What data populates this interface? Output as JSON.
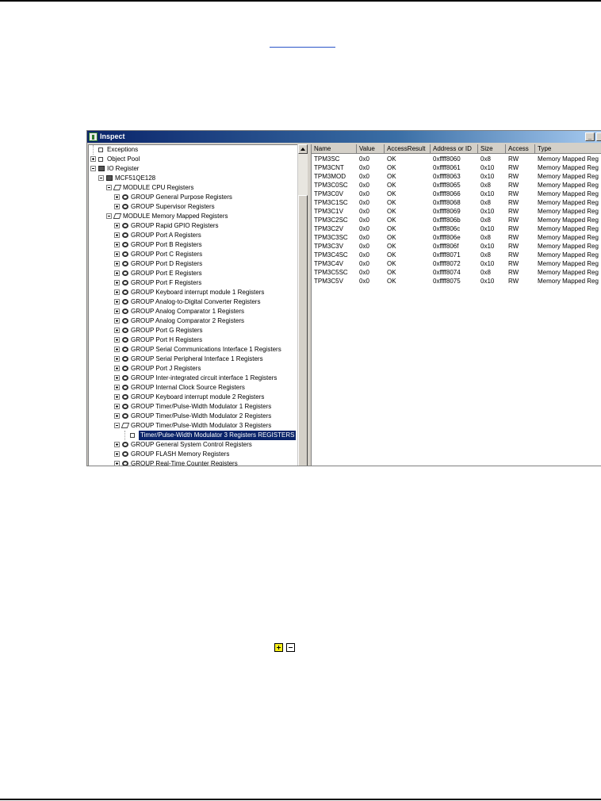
{
  "window": {
    "title": "Inspect",
    "minimize_label": "_"
  },
  "tree": [
    {
      "label": "Exceptions",
      "icon": "exceptions-icon",
      "expander": "none",
      "selected": false
    },
    {
      "label": "Object Pool",
      "icon": "object-pool-icon",
      "expander": "plus",
      "selected": false
    },
    {
      "label": "IO Register",
      "icon": "io-register-icon",
      "expander": "minus",
      "selected": false
    },
    {
      "label": "MCF51QE128",
      "icon": "chip-icon",
      "expander": "minus",
      "selected": false
    },
    {
      "label": "MODULE CPU Registers",
      "icon": "module-icon",
      "expander": "minus",
      "selected": false
    },
    {
      "label": "GROUP General Purpose Registers",
      "icon": "group-icon",
      "expander": "plus",
      "selected": false
    },
    {
      "label": "GROUP Supervisor Registers",
      "icon": "group-icon",
      "expander": "plus",
      "selected": false
    },
    {
      "label": "MODULE Memory Mapped Registers",
      "icon": "module-icon",
      "expander": "minus",
      "selected": false
    },
    {
      "label": "GROUP Rapid GPIO Registers",
      "icon": "group-icon",
      "expander": "plus",
      "selected": false
    },
    {
      "label": "GROUP Port A Registers",
      "icon": "group-icon",
      "expander": "plus",
      "selected": false
    },
    {
      "label": "GROUP Port B Registers",
      "icon": "group-icon",
      "expander": "plus",
      "selected": false
    },
    {
      "label": "GROUP Port C Registers",
      "icon": "group-icon",
      "expander": "plus",
      "selected": false
    },
    {
      "label": "GROUP Port D Registers",
      "icon": "group-icon",
      "expander": "plus",
      "selected": false
    },
    {
      "label": "GROUP Port E Registers",
      "icon": "group-icon",
      "expander": "plus",
      "selected": false
    },
    {
      "label": "GROUP Port F Registers",
      "icon": "group-icon",
      "expander": "plus",
      "selected": false
    },
    {
      "label": "GROUP Keyboard interrupt module 1 Registers",
      "icon": "group-icon",
      "expander": "plus",
      "selected": false
    },
    {
      "label": "GROUP Analog-to-Digital Converter Registers",
      "icon": "group-icon",
      "expander": "plus",
      "selected": false
    },
    {
      "label": "GROUP Analog Comparator 1 Registers",
      "icon": "group-icon",
      "expander": "plus",
      "selected": false
    },
    {
      "label": "GROUP Analog Comparator 2 Registers",
      "icon": "group-icon",
      "expander": "plus",
      "selected": false
    },
    {
      "label": "GROUP Port G Registers",
      "icon": "group-icon",
      "expander": "plus",
      "selected": false
    },
    {
      "label": "GROUP Port H Registers",
      "icon": "group-icon",
      "expander": "plus",
      "selected": false
    },
    {
      "label": "GROUP Serial Communications Interface 1 Registers",
      "icon": "group-icon",
      "expander": "plus",
      "selected": false
    },
    {
      "label": "GROUP Serial Peripheral Interface 1 Registers",
      "icon": "group-icon",
      "expander": "plus",
      "selected": false
    },
    {
      "label": "GROUP Port J Registers",
      "icon": "group-icon",
      "expander": "plus",
      "selected": false
    },
    {
      "label": "GROUP Inter-integrated circuit interface 1 Registers",
      "icon": "group-icon",
      "expander": "plus",
      "selected": false
    },
    {
      "label": "GROUP Internal Clock Source Registers",
      "icon": "group-icon",
      "expander": "plus",
      "selected": false
    },
    {
      "label": "GROUP Keyboard interrupt module 2 Registers",
      "icon": "group-icon",
      "expander": "plus",
      "selected": false
    },
    {
      "label": "GROUP Timer/Pulse-Width Modulator 1 Registers",
      "icon": "group-icon",
      "expander": "plus",
      "selected": false
    },
    {
      "label": "GROUP Timer/Pulse-Width Modulator 2 Registers",
      "icon": "group-icon",
      "expander": "plus",
      "selected": false
    },
    {
      "label": "GROUP Timer/Pulse-Width Modulator 3 Registers",
      "icon": "module-icon",
      "expander": "minus",
      "selected": false
    },
    {
      "label": "Timer/Pulse-Width Modulator 3 Registers REGISTERS",
      "icon": "register-list-icon",
      "expander": "none",
      "selected": true
    },
    {
      "label": "GROUP General System Control Registers",
      "icon": "group-icon",
      "expander": "plus",
      "selected": false
    },
    {
      "label": "GROUP FLASH Memory Registers",
      "icon": "group-icon",
      "expander": "plus",
      "selected": false
    },
    {
      "label": "GROUP Real-Time Counter Registers",
      "icon": "group-icon",
      "expander": "plus",
      "selected": false
    }
  ],
  "table": {
    "columns": [
      "Name",
      "Value",
      "AccessResult",
      "Address or ID",
      "Size",
      "Access",
      "Type"
    ],
    "rows": [
      [
        "TPM3SC",
        "0x0",
        "OK",
        "0xffff8060",
        "0x8",
        "RW",
        "Memory Mapped Reg"
      ],
      [
        "TPM3CNT",
        "0x0",
        "OK",
        "0xffff8061",
        "0x10",
        "RW",
        "Memory Mapped Reg"
      ],
      [
        "TPM3MOD",
        "0x0",
        "OK",
        "0xffff8063",
        "0x10",
        "RW",
        "Memory Mapped Reg"
      ],
      [
        "TPM3C0SC",
        "0x0",
        "OK",
        "0xffff8065",
        "0x8",
        "RW",
        "Memory Mapped Reg"
      ],
      [
        "TPM3C0V",
        "0x0",
        "OK",
        "0xffff8066",
        "0x10",
        "RW",
        "Memory Mapped Reg"
      ],
      [
        "TPM3C1SC",
        "0x0",
        "OK",
        "0xffff8068",
        "0x8",
        "RW",
        "Memory Mapped Reg"
      ],
      [
        "TPM3C1V",
        "0x0",
        "OK",
        "0xffff8069",
        "0x10",
        "RW",
        "Memory Mapped Reg"
      ],
      [
        "TPM3C2SC",
        "0x0",
        "OK",
        "0xffff806b",
        "0x8",
        "RW",
        "Memory Mapped Reg"
      ],
      [
        "TPM3C2V",
        "0x0",
        "OK",
        "0xffff806c",
        "0x10",
        "RW",
        "Memory Mapped Reg"
      ],
      [
        "TPM3C3SC",
        "0x0",
        "OK",
        "0xffff806e",
        "0x8",
        "RW",
        "Memory Mapped Reg"
      ],
      [
        "TPM3C3V",
        "0x0",
        "OK",
        "0xffff806f",
        "0x10",
        "RW",
        "Memory Mapped Reg"
      ],
      [
        "TPM3C4SC",
        "0x0",
        "OK",
        "0xffff8071",
        "0x8",
        "RW",
        "Memory Mapped Reg"
      ],
      [
        "TPM3C4V",
        "0x0",
        "OK",
        "0xffff8072",
        "0x10",
        "RW",
        "Memory Mapped Reg"
      ],
      [
        "TPM3C5SC",
        "0x0",
        "OK",
        "0xffff8074",
        "0x8",
        "RW",
        "Memory Mapped Reg"
      ],
      [
        "TPM3C5V",
        "0x0",
        "OK",
        "0xffff8075",
        "0x10",
        "RW",
        "Memory Mapped Reg"
      ]
    ]
  },
  "doc_icons": [
    "expand-plus-icon",
    "collapse-minus-icon"
  ],
  "colors": {
    "titlebar": "#0a246a",
    "selection": "#0a246a",
    "link": "#2a55c8",
    "plus_icon_fill": "#f7ef1a"
  }
}
